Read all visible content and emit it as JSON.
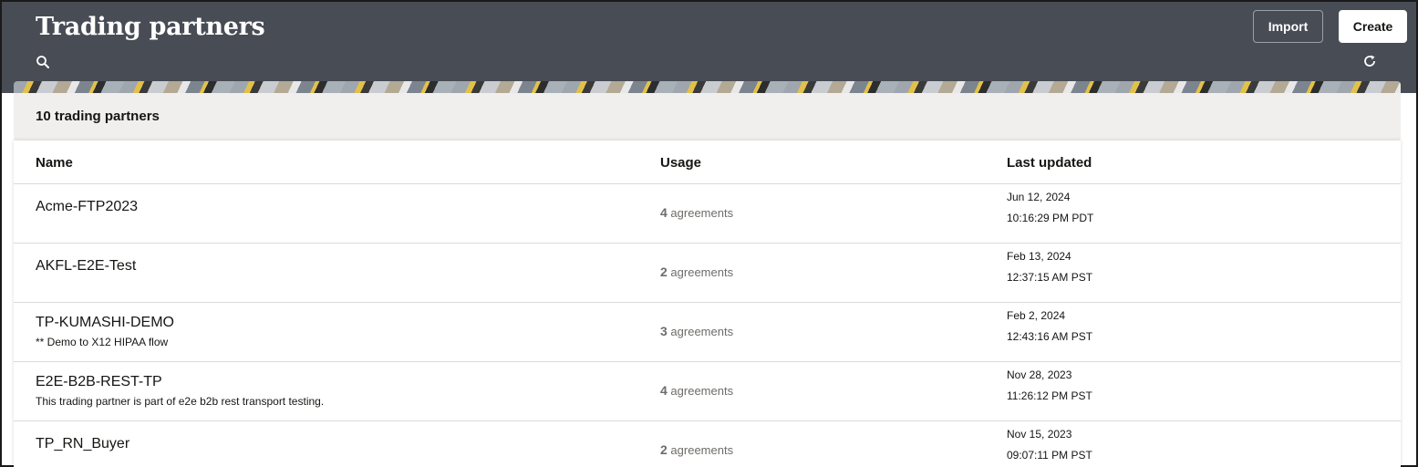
{
  "header": {
    "title": "Trading partners",
    "import_label": "Import",
    "create_label": "Create",
    "search_icon": "search-icon",
    "refresh_icon": "refresh-icon"
  },
  "summary": {
    "count_label": "10 trading partners"
  },
  "table": {
    "columns": {
      "name": "Name",
      "usage": "Usage",
      "updated": "Last updated"
    },
    "rows": [
      {
        "name": "Acme-FTP2023",
        "description": "",
        "usage_count": "4",
        "usage_unit": "agreements",
        "date": "Jun 12, 2024",
        "time": "10:16:29 PM PDT"
      },
      {
        "name": "AKFL-E2E-Test",
        "description": "",
        "usage_count": "2",
        "usage_unit": "agreements",
        "date": "Feb 13, 2024",
        "time": "12:37:15 AM PST"
      },
      {
        "name": "TP-KUMASHI-DEMO",
        "description": "** Demo to X12 HIPAA flow",
        "usage_count": "3",
        "usage_unit": "agreements",
        "date": "Feb 2, 2024",
        "time": "12:43:16 AM PST"
      },
      {
        "name": "E2E-B2B-REST-TP",
        "description": "This trading partner is part of e2e b2b rest transport testing.",
        "usage_count": "4",
        "usage_unit": "agreements",
        "date": "Nov 28, 2023",
        "time": "11:26:12 PM PST"
      },
      {
        "name": "TP_RN_Buyer",
        "description": "",
        "usage_count": "2",
        "usage_unit": "agreements",
        "date": "Nov 15, 2023",
        "time": "09:07:11 PM PST"
      }
    ]
  },
  "colors": {
    "header_bg": "#474c55",
    "count_bar_bg": "#f1efed",
    "text": "#161513",
    "muted_text": "#6f6c69"
  }
}
